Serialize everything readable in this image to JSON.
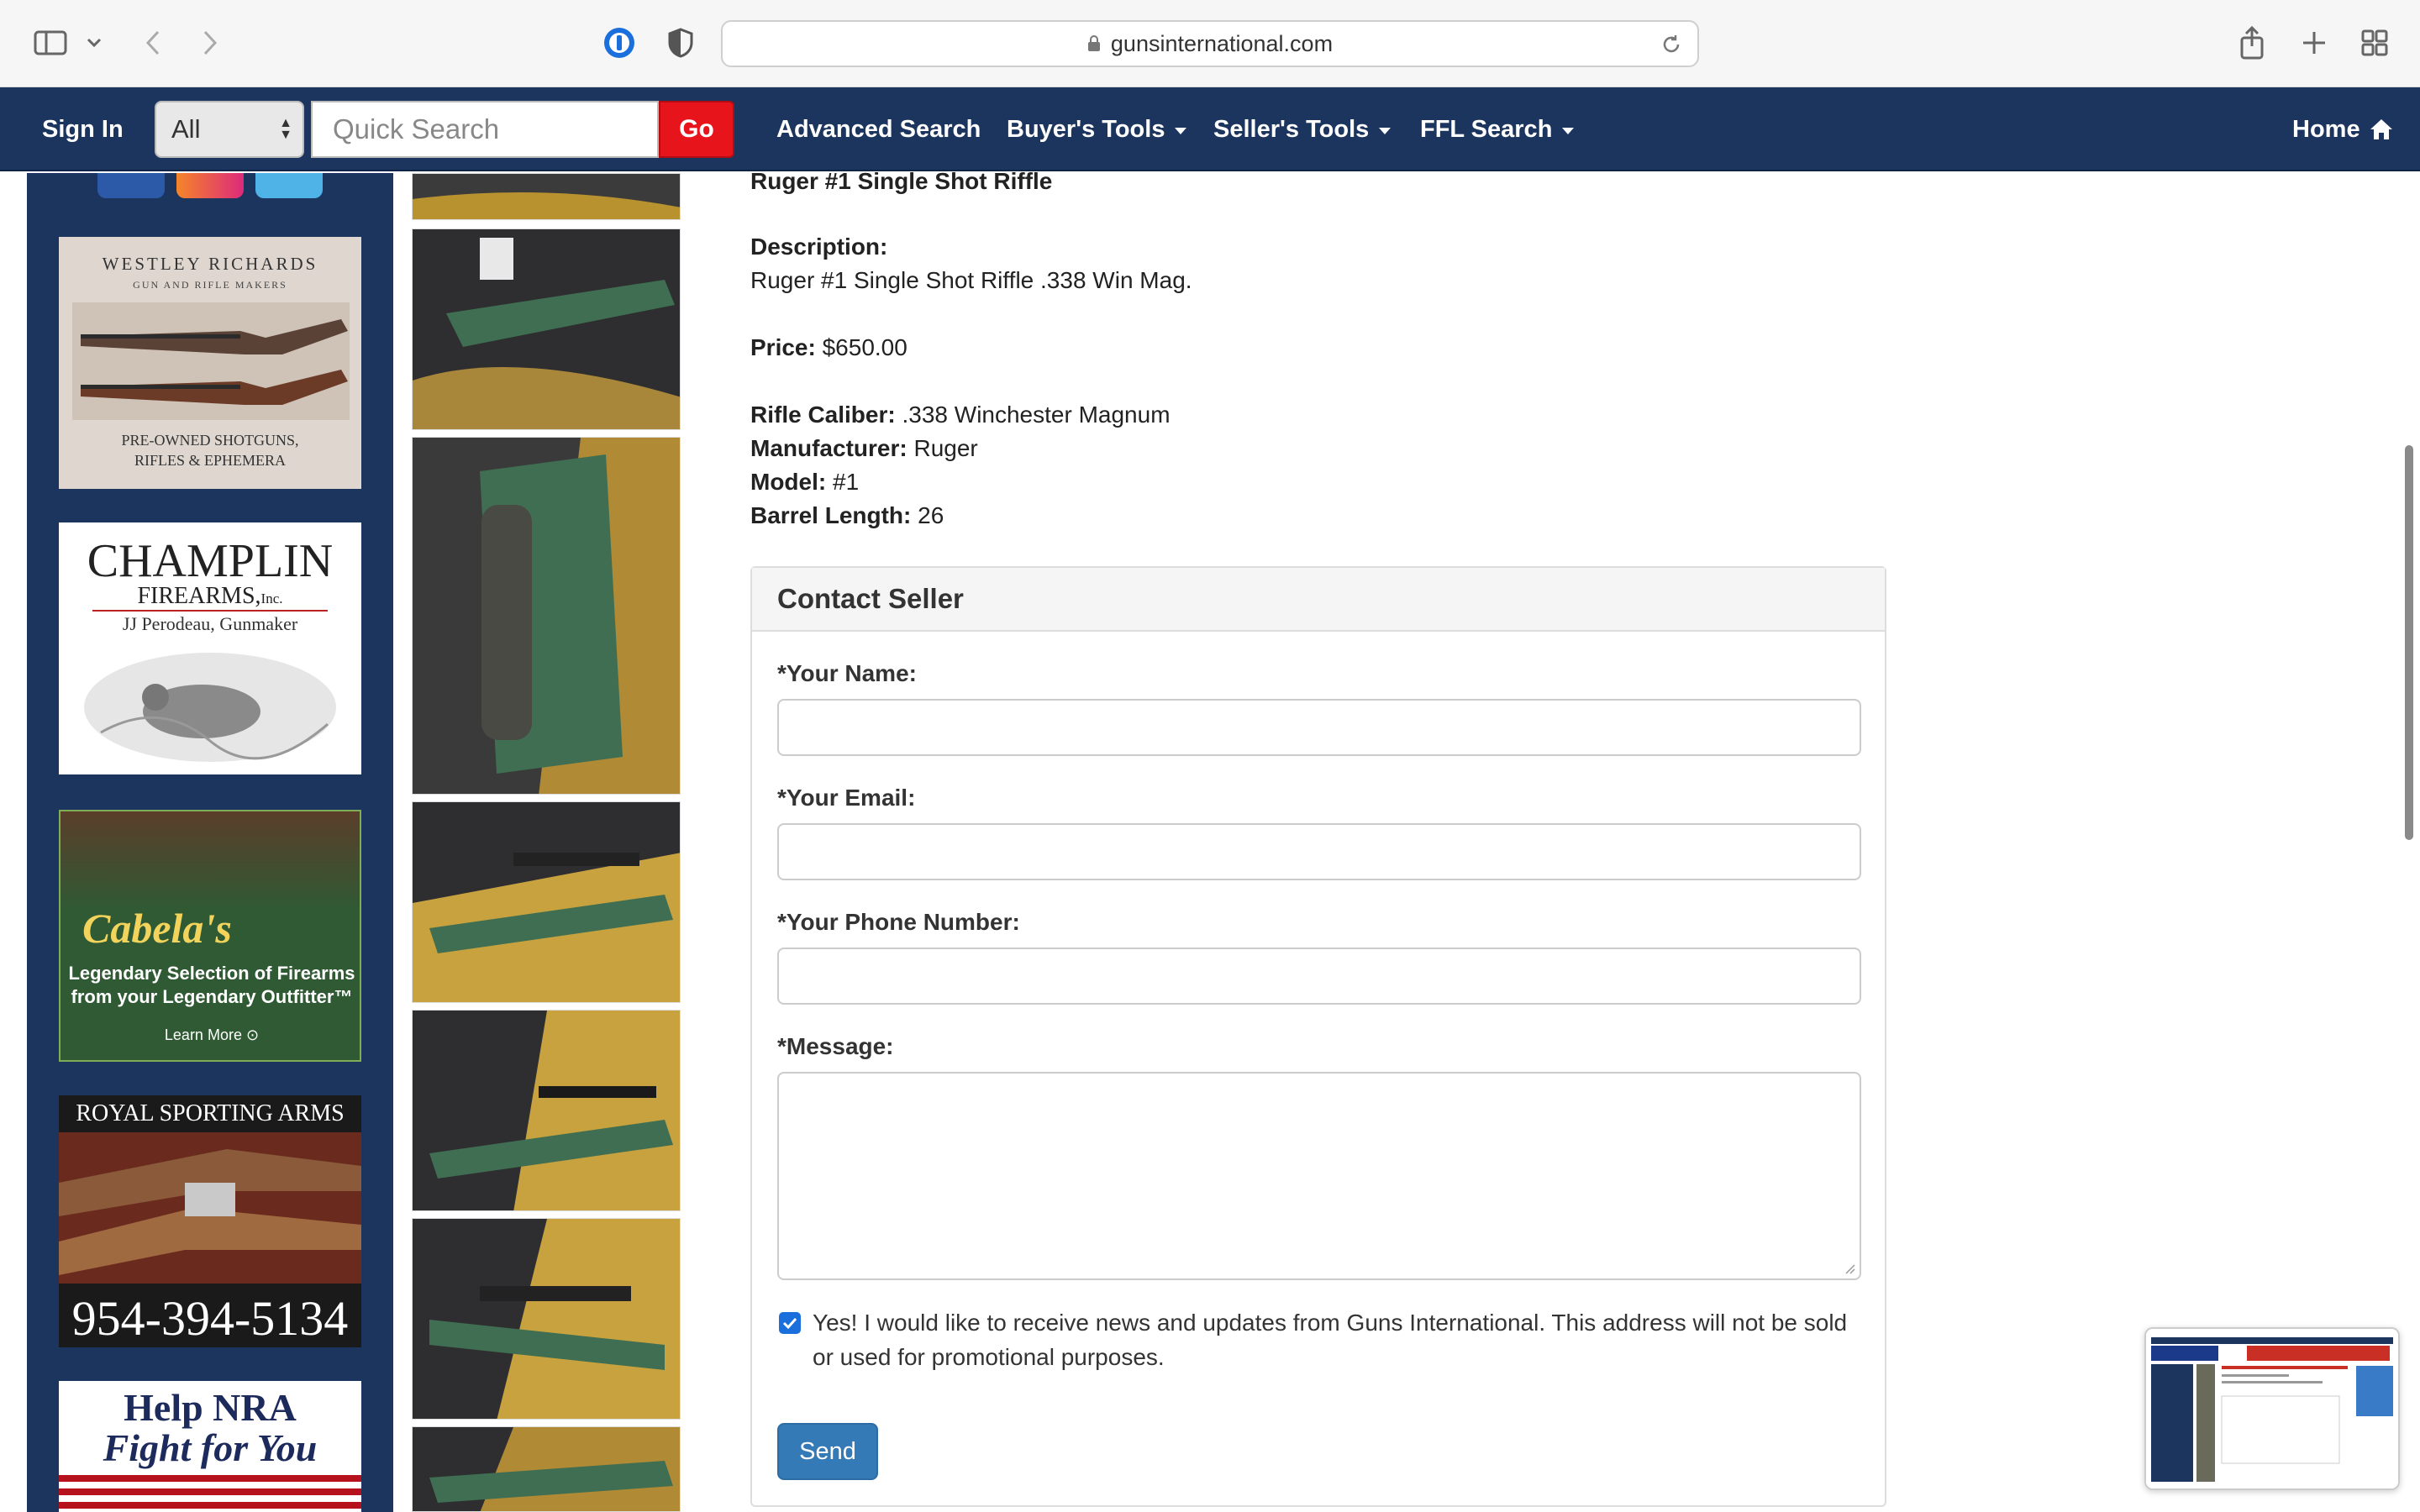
{
  "browser": {
    "url": "gunsinternational.com"
  },
  "nav": {
    "sign_in": "Sign In",
    "category_select": "All",
    "search_placeholder": "Quick Search",
    "go": "Go",
    "advanced_search": "Advanced Search",
    "buyers_tools": "Buyer's Tools",
    "sellers_tools": "Seller's Tools",
    "ffl_search": "FFL Search",
    "home": "Home"
  },
  "ads": {
    "westley_title": "WESTLEY RICHARDS",
    "westley_sub": "GUN AND RIFLE MAKERS",
    "westley_footer_1": "PRE-OWNED SHOTGUNS,",
    "westley_footer_2": "RIFLES & EPHEMERA",
    "champlin_title": "CHAMPLIN",
    "champlin_sub": "FIREARMS,",
    "champlin_inc": "Inc.",
    "champlin_maker": "JJ Perodeau, Gunmaker",
    "cabelas_title": "Cabela's",
    "cabelas_line1": "Legendary Selection of Firearms",
    "cabelas_line2": "from your Legendary Outfitter™",
    "cabelas_cta": "Learn More",
    "royal_title": "ROYAL SPORTING ARMS",
    "royal_phone": "954-394-5134",
    "nra_line1": "Help NRA",
    "nra_line2": "Fight for You"
  },
  "listing": {
    "title": "Ruger #1 Single Shot Riffle",
    "description_label": "Description:",
    "description": "Ruger #1 Single Shot Riffle .338 Win Mag.",
    "price_label": "Price:",
    "price": "$650.00",
    "caliber_label": "Rifle Caliber:",
    "caliber": ".338 Winchester Magnum",
    "manufacturer_label": "Manufacturer:",
    "manufacturer": "Ruger",
    "model_label": "Model:",
    "model": "#1",
    "barrel_label": "Barrel Length:",
    "barrel": "26"
  },
  "contact": {
    "heading": "Contact Seller",
    "name_label": "*Your Name:",
    "email_label": "*Your Email:",
    "phone_label": "*Your Phone Number:",
    "message_label": "*Message:",
    "optin_text": "Yes! I would like to receive news and updates from Guns International. This address will not be sold or used for promotional purposes.",
    "optin_checked": true,
    "send": "Send"
  },
  "colors": {
    "nav_bg": "#1c355e",
    "go_red": "#e8141c",
    "send_blue": "#337ab7",
    "checkbox_blue": "#1a6fdc"
  }
}
